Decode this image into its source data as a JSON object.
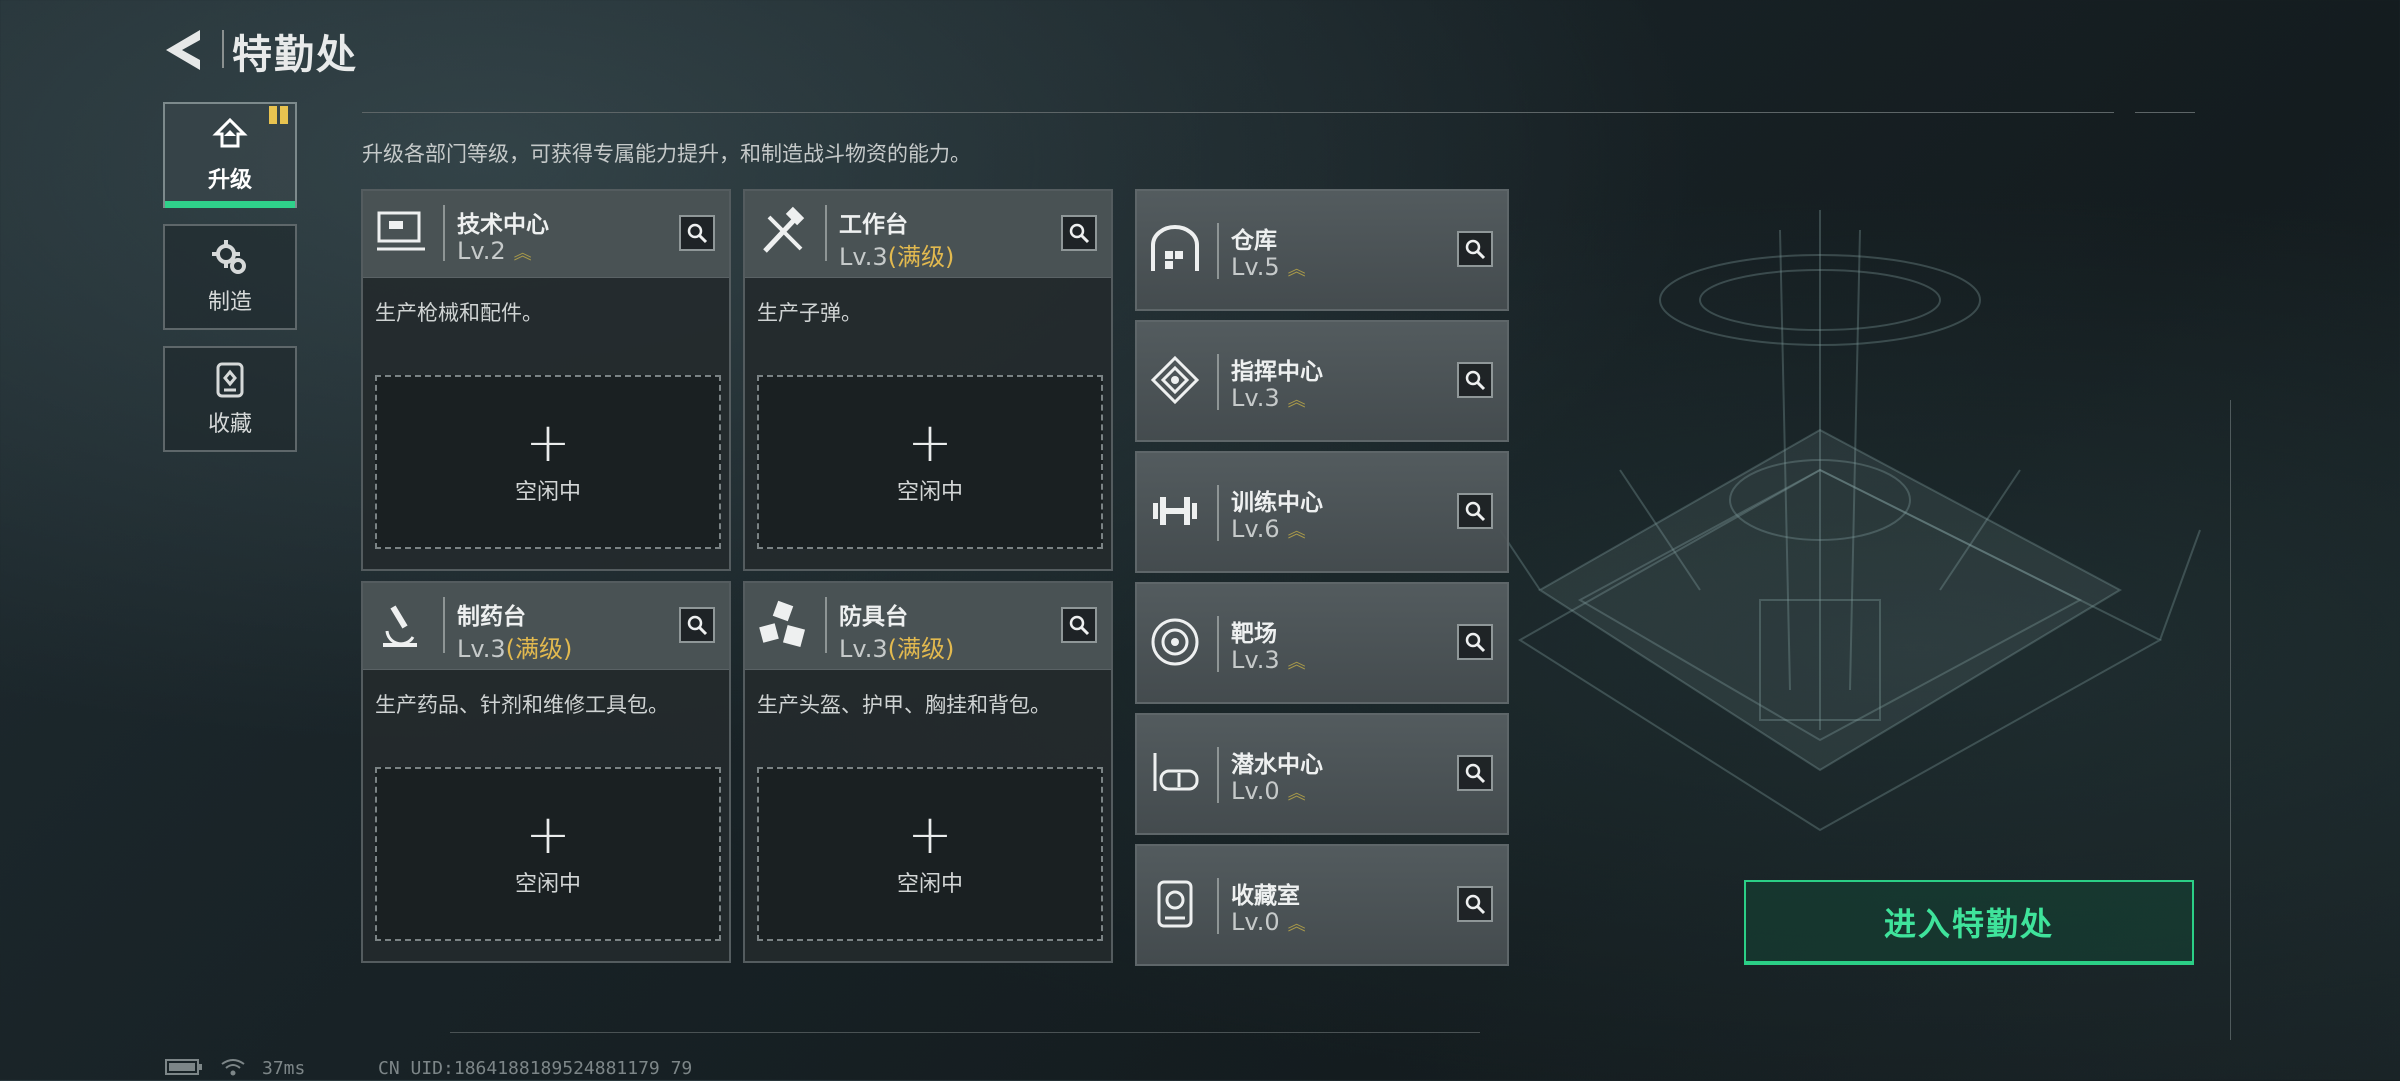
{
  "header": {
    "title": "特勤处"
  },
  "side_tabs": [
    {
      "label": "升级",
      "icon": "upgrade-icon",
      "active": true
    },
    {
      "label": "制造",
      "icon": "gear-icon",
      "active": false
    },
    {
      "label": "收藏",
      "icon": "collection-icon",
      "active": false
    }
  ],
  "description": "升级各部门等级，可获得专属能力提升，和制造战斗物资的能力。",
  "big_cards": [
    {
      "name": "技术中心",
      "level": "Lv.2",
      "max": "",
      "desc": "生产枪械和配件。",
      "icon": "monitor-icon",
      "slot_label": "空闲中"
    },
    {
      "name": "工作台",
      "level": "Lv.3",
      "max": "(满级)",
      "desc": "生产子弹。",
      "icon": "tools-icon",
      "slot_label": "空闲中"
    },
    {
      "name": "制药台",
      "level": "Lv.3",
      "max": "(满级)",
      "desc": "生产药品、针剂和维修工具包。",
      "icon": "microscope-icon",
      "slot_label": "空闲中"
    },
    {
      "name": "防具台",
      "level": "Lv.3",
      "max": "(满级)",
      "desc": "生产头盔、护甲、胸挂和背包。",
      "icon": "armor-blocks-icon",
      "slot_label": "空闲中"
    }
  ],
  "small_cards": [
    {
      "name": "仓库",
      "level": "Lv.5",
      "icon": "warehouse-icon"
    },
    {
      "name": "指挥中心",
      "level": "Lv.3",
      "icon": "command-icon"
    },
    {
      "name": "训练中心",
      "level": "Lv.6",
      "icon": "dumbbell-icon"
    },
    {
      "name": "靶场",
      "level": "Lv.3",
      "icon": "target-icon"
    },
    {
      "name": "潜水中心",
      "level": "Lv.0",
      "icon": "diving-mask-icon"
    },
    {
      "name": "收藏室",
      "level": "Lv.0",
      "icon": "trophy-case-icon"
    }
  ],
  "enter_button": "进入特勤处",
  "status": {
    "ping": "37ms",
    "uid": "CN UID:1864188189524881179 79"
  },
  "colors": {
    "accent": "#2bcf86",
    "max_level": "#e2b94f",
    "badge": "#e8c350"
  }
}
